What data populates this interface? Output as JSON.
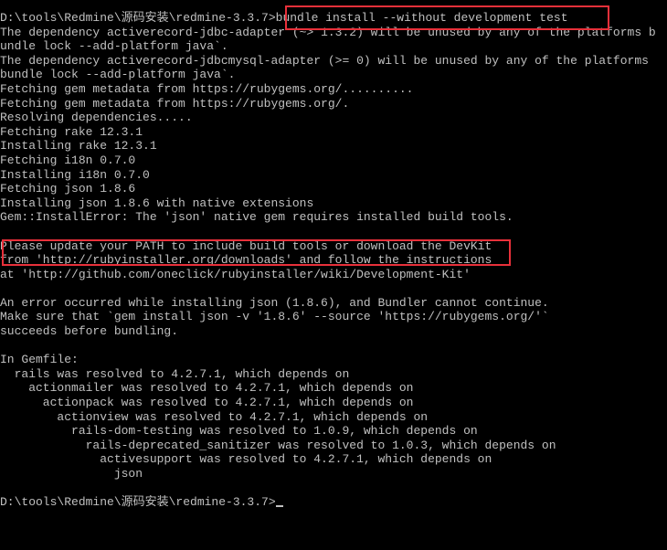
{
  "console": {
    "lines": [
      "D:\\tools\\Redmine\\源码安装\\redmine-3.3.7>bundle install --without development test",
      "The dependency activerecord-jdbc-adapter (~> 1.3.2) will be unused by any of the platforms b",
      "undle lock --add-platform java`.",
      "The dependency activerecord-jdbcmysql-adapter (>= 0) will be unused by any of the platforms",
      "bundle lock --add-platform java`.",
      "Fetching gem metadata from https://rubygems.org/..........",
      "Fetching gem metadata from https://rubygems.org/.",
      "Resolving dependencies.....",
      "Fetching rake 12.3.1",
      "Installing rake 12.3.1",
      "Fetching i18n 0.7.0",
      "Installing i18n 0.7.0",
      "Fetching json 1.8.6",
      "Installing json 1.8.6 with native extensions",
      "Gem::InstallError: The 'json' native gem requires installed build tools.",
      "",
      "Please update your PATH to include build tools or download the DevKit",
      "from 'http://rubyinstaller.org/downloads' and follow the instructions",
      "at 'http://github.com/oneclick/rubyinstaller/wiki/Development-Kit'",
      "",
      "An error occurred while installing json (1.8.6), and Bundler cannot continue.",
      "Make sure that `gem install json -v '1.8.6' --source 'https://rubygems.org/'`",
      "succeeds before bundling.",
      "",
      "In Gemfile:",
      "  rails was resolved to 4.2.7.1, which depends on",
      "    actionmailer was resolved to 4.2.7.1, which depends on",
      "      actionpack was resolved to 4.2.7.1, which depends on",
      "        actionview was resolved to 4.2.7.1, which depends on",
      "          rails-dom-testing was resolved to 1.0.9, which depends on",
      "            rails-deprecated_sanitizer was resolved to 1.0.3, which depends on",
      "              activesupport was resolved to 4.2.7.1, which depends on",
      "                json",
      "",
      "D:\\tools\\Redmine\\源码安装\\redmine-3.3.7>"
    ]
  },
  "colors": {
    "background": "#000000",
    "text": "#c0c0c0",
    "highlight": "#e8303a"
  }
}
